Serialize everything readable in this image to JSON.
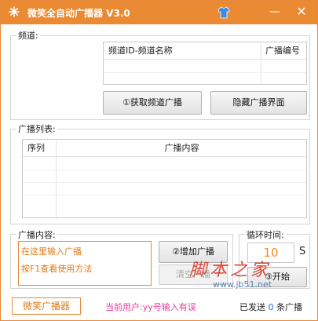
{
  "window": {
    "title": "微笑全自动广播器 V3.0",
    "minimize_glyph": "—",
    "close_glyph": "✕",
    "accent_color": "#ea8a32"
  },
  "channel_group": {
    "label": "频道:",
    "columns": [
      "频道ID-频道名称",
      "广播编号"
    ],
    "get_button": "①获取频道广播",
    "hide_button": "隐藏广播界面"
  },
  "broadcast_list": {
    "label": "广播列表:",
    "columns": [
      "序列",
      "广播内容"
    ]
  },
  "content_group": {
    "label": "广播内容:",
    "text_value": "在这里输入广播\n按F1查看使用方法",
    "add_button": "②增加广播",
    "clear_button": "清空广播"
  },
  "loop_group": {
    "label": "循环时间:",
    "value": "10",
    "unit": "S",
    "start_button": "③开始"
  },
  "status": {
    "brand": "微笑广播器",
    "current_user": "当前用户:yy号输入有误",
    "sent_prefix": "已发送",
    "sent_count": "0",
    "sent_suffix": "条广播"
  },
  "watermark": {
    "text": "脚本之家",
    "url": "www.jb51.net"
  }
}
